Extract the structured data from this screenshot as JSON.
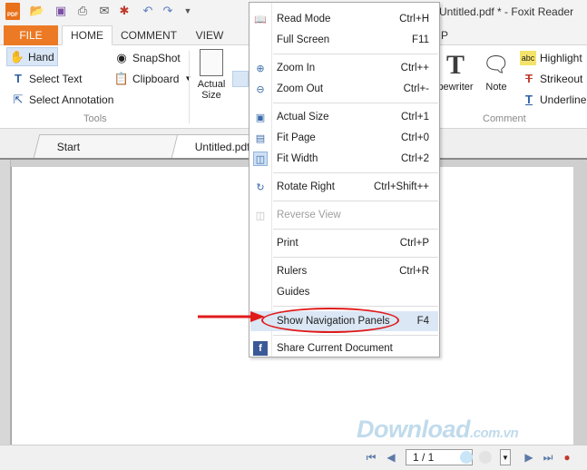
{
  "window": {
    "title": "Untitled.pdf * - Foxit Reader",
    "logo_text": "PDF"
  },
  "quick_access": [
    "open-folder-icon",
    "save-icon",
    "print-icon",
    "email-icon",
    "new-icon",
    "undo-icon",
    "redo-icon",
    "customize-icon"
  ],
  "ribbon_tabs": {
    "file": "FILE",
    "home": "HOME",
    "comment": "COMMENT",
    "view": "VIEW",
    "p_partial": "P"
  },
  "tools_group": {
    "hand": "Hand",
    "select_text": "Select Text",
    "select_annotation": "Select Annotation",
    "snapshot": "SnapShot",
    "clipboard": "Clipboard",
    "label": "Tools"
  },
  "view_group": {
    "actual_size_line1": "Actual",
    "actual_size_line2": "Size"
  },
  "comment_group": {
    "typewriter": "pewriter",
    "note": "Note",
    "highlight": "Highlight",
    "strikeout": "Strikeout",
    "underline": "Underline",
    "label": "Comment"
  },
  "doc_tabs": {
    "start": "Start",
    "untitled": "Untitled.pdf"
  },
  "menu": {
    "read_mode": {
      "label": "Read Mode",
      "shortcut": "Ctrl+H"
    },
    "full_screen": {
      "label": "Full Screen",
      "shortcut": "F11"
    },
    "zoom_in": {
      "label": "Zoom In",
      "shortcut": "Ctrl++"
    },
    "zoom_out": {
      "label": "Zoom Out",
      "shortcut": "Ctrl+-"
    },
    "actual_size": {
      "label": "Actual Size",
      "shortcut": "Ctrl+1"
    },
    "fit_page": {
      "label": "Fit Page",
      "shortcut": "Ctrl+0"
    },
    "fit_width": {
      "label": "Fit Width",
      "shortcut": "Ctrl+2"
    },
    "rotate_right": {
      "label": "Rotate Right",
      "shortcut": "Ctrl+Shift++"
    },
    "reverse_view": {
      "label": "Reverse View",
      "shortcut": ""
    },
    "print": {
      "label": "Print",
      "shortcut": "Ctrl+P"
    },
    "rulers": {
      "label": "Rulers",
      "shortcut": "Ctrl+R"
    },
    "guides": {
      "label": "Guides",
      "shortcut": ""
    },
    "show_nav_panels": {
      "label": "Show Navigation Panels",
      "shortcut": "F4"
    },
    "share_doc": {
      "label": "Share Current Document",
      "shortcut": ""
    }
  },
  "status": {
    "page_value": "1 / 1"
  },
  "watermark": {
    "main": "Download",
    "suffix": ".com.vn"
  },
  "colors": {
    "file_tab": "#ec7a25",
    "highlight": "#dbe7f5",
    "annotation_red": "#e01b1b"
  }
}
